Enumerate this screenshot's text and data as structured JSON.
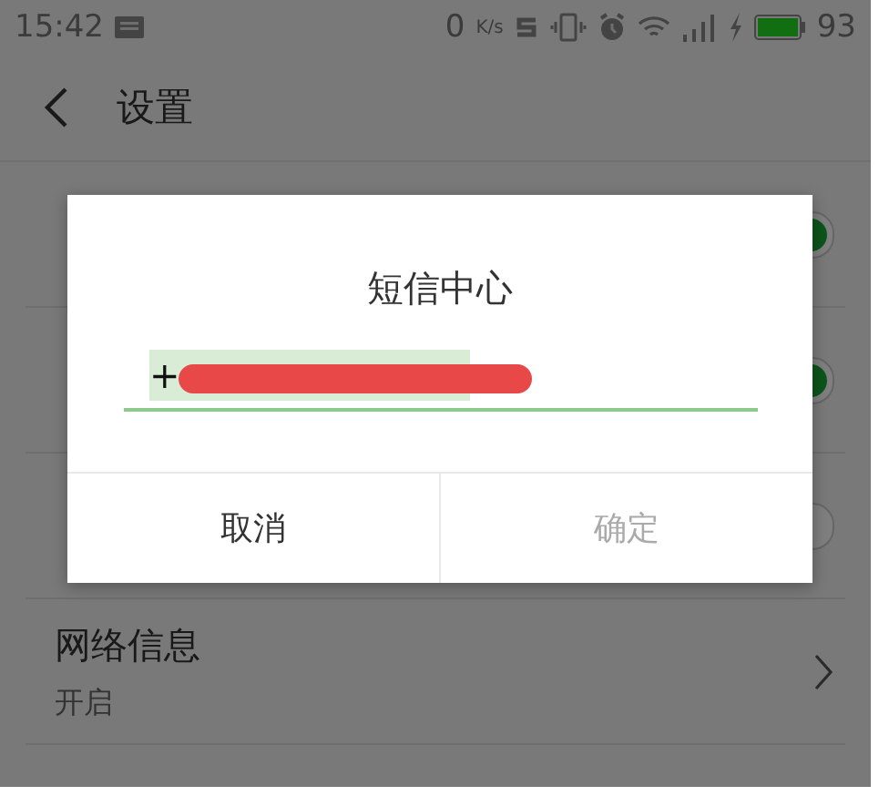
{
  "status_bar": {
    "time": "15:42",
    "speed": "0",
    "speed_unit": "K/s",
    "battery": "93"
  },
  "header": {
    "title": "设置"
  },
  "settings": {
    "rows": [
      {
        "kind": "toggle",
        "on": true
      },
      {
        "kind": "toggle",
        "on": true
      },
      {
        "kind": "toggle",
        "on": false
      },
      {
        "kind": "link",
        "title": "网络信息",
        "subtitle": "开启"
      }
    ]
  },
  "dialog": {
    "title": "短信中心",
    "field": {
      "value": "+",
      "text_selected": true
    },
    "buttons": [
      {
        "label": "取消",
        "disabled": false
      },
      {
        "label": "确定",
        "disabled": true
      }
    ]
  }
}
